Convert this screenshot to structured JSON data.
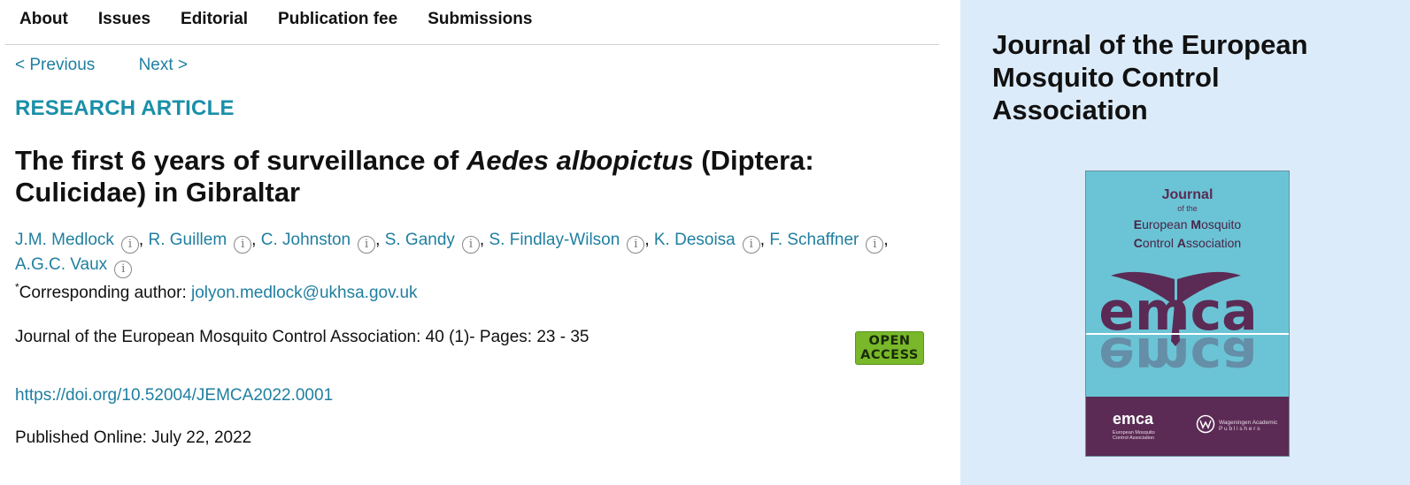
{
  "nav": {
    "items": [
      "About",
      "Issues",
      "Editorial",
      "Publication fee",
      "Submissions"
    ]
  },
  "pager": {
    "previous": "< Previous",
    "next": "Next >"
  },
  "article": {
    "type_label": "RESEARCH ARTICLE",
    "title_part1": "The first 6 years of surveillance of ",
    "title_italic": "Aedes albopictus",
    "title_part2": " (Diptera: Culicidae) in Gibraltar",
    "authors": [
      "J.M. Medlock",
      "R. Guillem",
      "C. Johnston",
      "S. Gandy",
      "S. Findlay-Wilson",
      "K. Desoisa",
      "F. Schaffner",
      "A.G.C. Vaux"
    ],
    "author_info_glyph": "i",
    "author_separator": ", ",
    "corresponding_marker": "*",
    "corresponding_label": "Corresponding author: ",
    "corresponding_email": "jolyon.medlock@ukhsa.gov.uk",
    "citation": "Journal of the European Mosquito Control Association: 40 (1)- Pages: 23 - 35",
    "open_access_line1": "OPEN",
    "open_access_line2": "ACCESS",
    "doi": "https://doi.org/10.52004/JEMCA2022.0001",
    "published": "Published Online: July 22, 2022"
  },
  "sidebar": {
    "journal_title": "Journal of the European Mosquito Control Association",
    "cover": {
      "journal_word": "Journal",
      "of_the": "of the",
      "subtitle_line1_pre": "E",
      "subtitle_line1_mid": "uropean ",
      "subtitle_line1_b2": "M",
      "subtitle_line1_post": "osquito",
      "subtitle_line2_pre": "C",
      "subtitle_line2_mid": "ontrol ",
      "subtitle_line2_b2": "A",
      "subtitle_line2_post": "ssociation",
      "logo_text": "emca",
      "footer_emca": "emca",
      "footer_emca_lines": [
        "European Mosquito",
        "Control Association"
      ],
      "footer_publisher_lines": [
        "Wageningen Academic",
        "P u b l i s h e r s"
      ]
    }
  },
  "colors": {
    "link": "#1f7fa0",
    "type_label": "#1a8fa8",
    "sidebar_bg": "#dcebf9",
    "cover_cyan": "#6bc4d5",
    "cover_plum": "#5b2b55",
    "open_access_green": "#78b82a"
  }
}
